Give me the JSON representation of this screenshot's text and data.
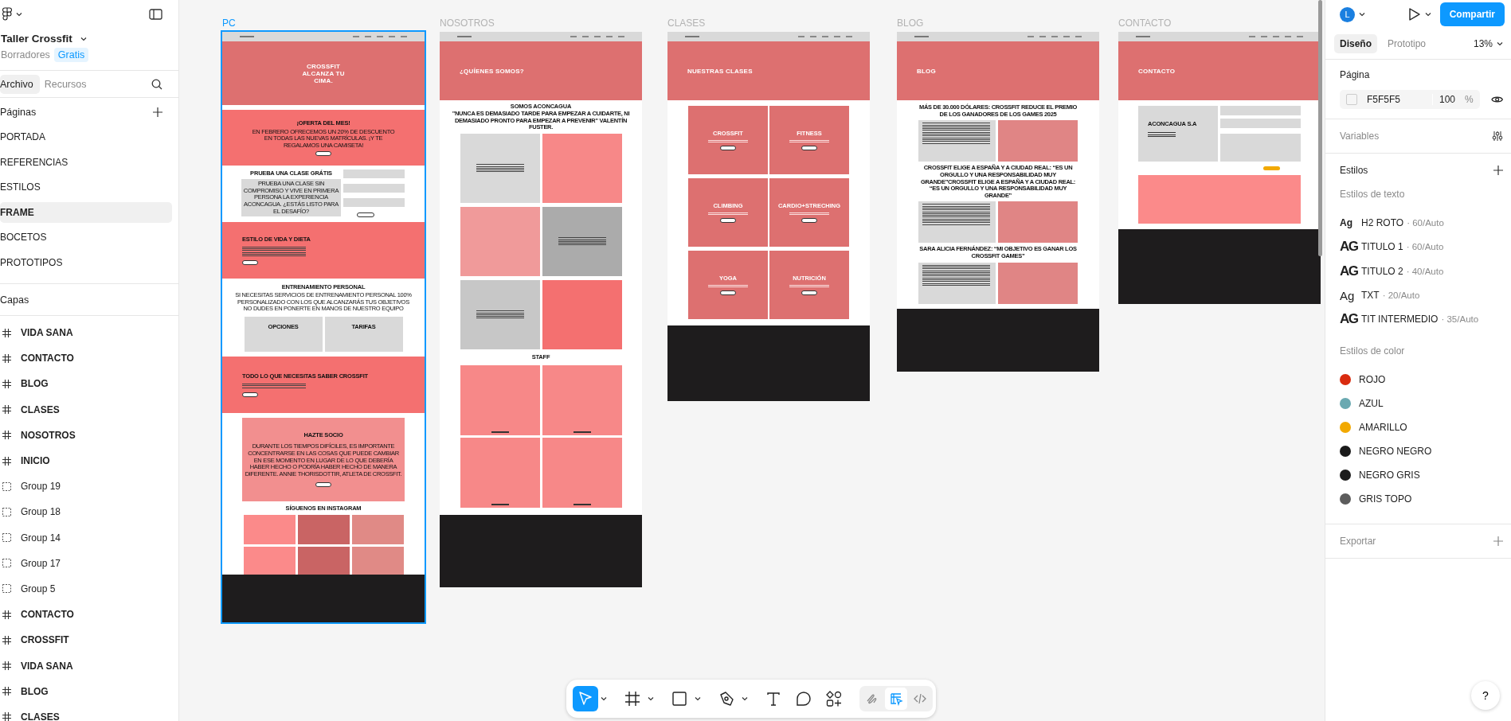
{
  "app": {
    "file_name": "Taller Crossfit",
    "location": "Borradores",
    "plan": "Gratis"
  },
  "left_tabs": [
    {
      "label": "Archivo",
      "selected": true
    },
    {
      "label": "Recursos",
      "selected": false
    }
  ],
  "pages": {
    "title": "Páginas",
    "items": [
      {
        "label": "PORTADA",
        "selected": false
      },
      {
        "label": "REFERENCIAS",
        "selected": false
      },
      {
        "label": "ESTILOS",
        "selected": false
      },
      {
        "label": "FRAME",
        "selected": true
      },
      {
        "label": "BOCETOS",
        "selected": false
      },
      {
        "label": "PROTOTIPOS",
        "selected": false
      }
    ]
  },
  "layers": {
    "title": "Capas",
    "items": [
      {
        "label": "VIDA SANA",
        "kind": "frame"
      },
      {
        "label": "CONTACTO",
        "kind": "frame"
      },
      {
        "label": "BLOG",
        "kind": "frame"
      },
      {
        "label": "CLASES",
        "kind": "frame"
      },
      {
        "label": "NOSOTROS",
        "kind": "frame"
      },
      {
        "label": "INICIO",
        "kind": "frame"
      },
      {
        "label": "Group 19",
        "kind": "group"
      },
      {
        "label": "Group 18",
        "kind": "group"
      },
      {
        "label": "Group 14",
        "kind": "group"
      },
      {
        "label": "Group 17",
        "kind": "group"
      },
      {
        "label": "Group 5",
        "kind": "group"
      },
      {
        "label": "CONTACTO",
        "kind": "frame"
      },
      {
        "label": "CROSSFIT",
        "kind": "frame"
      },
      {
        "label": "VIDA SANA",
        "kind": "frame"
      },
      {
        "label": "BLOG",
        "kind": "frame"
      },
      {
        "label": "CLASES",
        "kind": "frame"
      }
    ]
  },
  "frames": [
    {
      "label": "PC",
      "selected": true,
      "kind": "home",
      "hero": "CROSSFIT ALCANZA TU CIMA.",
      "offer": {
        "title": "¡OFERTA DEL MES!",
        "text": "EN FEBRERO OFRECEMOS UN 20% DE DESCUENTO EN TODAS LAS NUEVAS MATRÍCULAS. ¡Y TE REGALAMOS UNA CAMISETA!"
      },
      "trial": {
        "title": "PRUEBA UNA CLASE GRÁTIS",
        "text": "PRUEBA UNA CLASE SIN COMPROMISO Y VIVE EN PRIMERA PERSONA LA EXPERIENCIA ACONCAGUA. ¿ESTÁS LISTO PARA EL DESAFÍO?"
      },
      "lifestyle": {
        "title": "ESTILO DE VIDA Y DIETA"
      },
      "training": {
        "title": "ENTRENAMIENTO PERSONAL",
        "text": "SI NECESITAS SERVICIOS DE ENTRENAMIENTO PERSONAL 100% PERSONALIZADO CON LOS QUE ALCANZARÁS TUS OBJETIVOS NO DUDES EN PONERTE EN MANOS DE NUESTRO EQUIPO",
        "cards": [
          "OPCIONES",
          "TARIFAS"
        ]
      },
      "crossfit": {
        "title": "TODO LO QUE NECESITAS SABER CROSSFIT"
      },
      "member": {
        "title": "HAZTE SOCIO",
        "text": "DURANTE LOS TIEMPOS DIFÍCILES, ES IMPORTANTE CONCENTRARSE EN LAS COSAS QUE PUEDE CAMBIAR EN ESE MOMENTO EN LUGAR DE LO QUE DEBERÍA HABER HECHO O PODRÍA HABER HECHO DE MANERA DIFERENTE. ANNIE THORISDOTTIR, ATLETA DE CROSSFIT."
      },
      "instagram": {
        "title": "SÍGUENOS EN INSTAGRAM",
        "tiles": [
          {
            "color": "#fb8a8a"
          },
          {
            "color": "#c96464"
          },
          {
            "color": "#e08a86"
          },
          {
            "color": "#fb8a8a"
          },
          {
            "color": "#c96464"
          },
          {
            "color": "#e08a86"
          }
        ]
      }
    },
    {
      "label": "NOSOTROS",
      "selected": false,
      "kind": "about",
      "hero": "¿QUÍENES SOMOS?",
      "intro_title": "SOMOS ACONCAGUA",
      "quote": "\"NUNCA ES DEMASIADO TARDE PARA EMPEZAR A CUIDARTE, NI DEMASIADO PRONTO PARA EMPEZAR A PREVENIR\" VALENTÍN FUSTER.",
      "tiles": [
        {
          "kind": "text",
          "color": "#d9d9d9"
        },
        {
          "kind": "image",
          "color": "#f78888"
        },
        {
          "kind": "image",
          "color": "#f09a9a"
        },
        {
          "kind": "text",
          "color": "#ababab"
        },
        {
          "kind": "text",
          "color": "#c7c7c7"
        },
        {
          "kind": "image",
          "color": "#f47070"
        }
      ],
      "staff_title": "STAFF",
      "staff": [
        {
          "color": "#f78888"
        },
        {
          "color": "#f78888"
        },
        {
          "color": "#f78888"
        },
        {
          "color": "#f78888"
        }
      ]
    },
    {
      "label": "CLASES",
      "selected": false,
      "kind": "classes",
      "hero": "NUESTRAS CLASES",
      "classes": [
        {
          "name": "CROSSFIT"
        },
        {
          "name": "FITNESS"
        },
        {
          "name": "CLIMBING"
        },
        {
          "name": "CARDIO+STRECHING"
        },
        {
          "name": "YOGA"
        },
        {
          "name": "NUTRICIÓN"
        }
      ]
    },
    {
      "label": "BLOG",
      "selected": false,
      "kind": "blog",
      "hero": "BLOG",
      "posts": [
        {
          "title": "MÁS DE 30.000 DÓLARES: CROSSFIT REDUCE EL PREMIO DE LOS GANADORES DE LOS GAMES 2025"
        },
        {
          "title": "CROSSFIT ELIGE A ESPAÑA Y A CIUDAD REAL: “ES UN ORGULLO Y UNA RESPONSABILIDAD MUY GRANDE”CROSSFIT ELIGE A ESPAÑA Y A CIUDAD REAL: “ES UN ORGULLO Y UNA RESPONSABILIDAD MUY GRANDE”"
        },
        {
          "title": "SARA ALICIA FERNÁNDEZ: “MI OBJETIVO ES GANAR LOS CROSSFIT GAMES”"
        }
      ]
    },
    {
      "label": "CONTACTO",
      "selected": false,
      "kind": "contact",
      "hero": "CONTACTO",
      "company": "ACONCAGUA S.A"
    }
  ],
  "toolbar": {
    "tools": [
      {
        "kind": "move",
        "selected": true,
        "dropdown": true
      },
      {
        "kind": "frame",
        "selected": false,
        "dropdown": true
      },
      {
        "kind": "shape",
        "selected": false,
        "dropdown": true
      },
      {
        "kind": "pen",
        "selected": false,
        "dropdown": true
      },
      {
        "kind": "text",
        "selected": false,
        "dropdown": false
      },
      {
        "kind": "comment",
        "selected": false,
        "dropdown": false
      },
      {
        "kind": "actions",
        "selected": false,
        "dropdown": false
      }
    ],
    "modes": [
      {
        "kind": "draw",
        "selected": false
      },
      {
        "kind": "design",
        "selected": true
      },
      {
        "kind": "dev",
        "selected": false
      }
    ]
  },
  "right_panel": {
    "avatar": "L",
    "share": "Compartir",
    "tabs": [
      {
        "label": "Diseño",
        "selected": true
      },
      {
        "label": "Prototipo",
        "selected": false
      }
    ],
    "zoom": "13%",
    "page": {
      "title": "Página",
      "color_hex": "F5F5F5",
      "opacity": "100",
      "unit": "%"
    },
    "variables": "Variables",
    "styles_title": "Estilos",
    "text_styles_title": "Estilos de texto",
    "text_styles": [
      {
        "sample": "Ag",
        "kind": "heavy",
        "name": "H2 ROTO",
        "spec": "· 60/Auto"
      },
      {
        "sample": "AG",
        "kind": "condensed",
        "name": "TITULO 1",
        "spec": "· 60/Auto"
      },
      {
        "sample": "AG",
        "kind": "condensed",
        "name": "TITULO 2",
        "spec": "· 40/Auto"
      },
      {
        "sample": "Ag",
        "kind": "regular",
        "name": "TXT",
        "spec": "· 20/Auto"
      },
      {
        "sample": "AG",
        "kind": "condensed",
        "name": "TIT INTERMEDIO",
        "spec": "· 35/Auto"
      }
    ],
    "color_styles_title": "Estilos de color",
    "color_styles": [
      {
        "name": "ROJO",
        "color": "#d92b0f"
      },
      {
        "name": "AZUL",
        "color": "#6aa9b1"
      },
      {
        "name": "AMARILLO",
        "color": "#f2a900"
      },
      {
        "name": "NEGRO NEGRO",
        "color": "#1a1a1a"
      },
      {
        "name": "NEGRO GRIS",
        "color": "#1c1c1c"
      },
      {
        "name": "GRIS TOPO",
        "color": "#5c5c5c"
      }
    ],
    "export": "Exportar",
    "help": "?"
  }
}
